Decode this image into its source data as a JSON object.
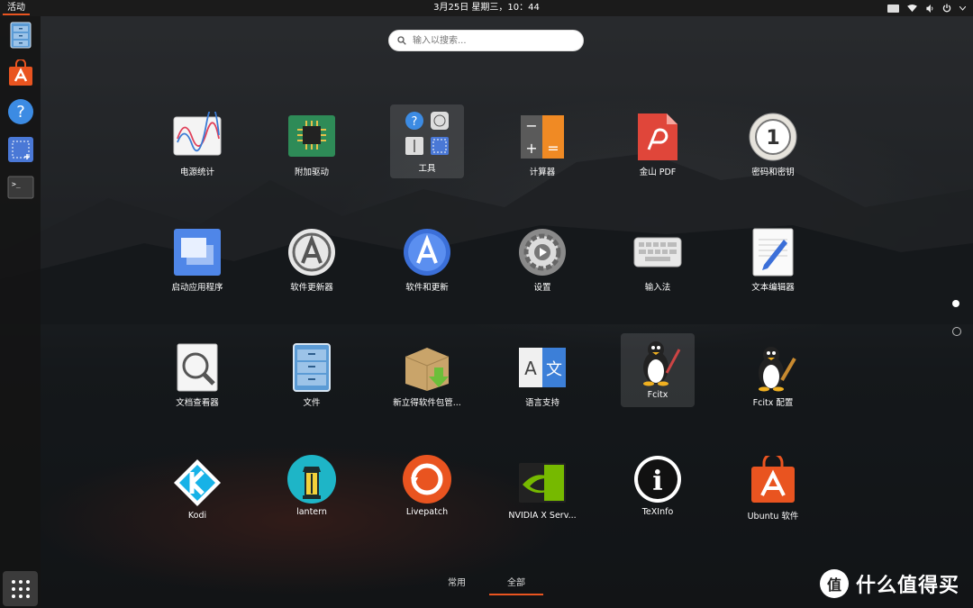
{
  "topbar": {
    "activities": "活动",
    "clock": "3月25日 星期三，10：44"
  },
  "dock": {
    "items": [
      {
        "name": "files",
        "icon": "file-cabinet-icon"
      },
      {
        "name": "ubuntu-software",
        "icon": "shopping-bag-icon"
      },
      {
        "name": "help",
        "icon": "question-icon"
      },
      {
        "name": "screenshot",
        "icon": "screenshot-icon"
      },
      {
        "name": "terminal",
        "icon": "terminal-icon"
      }
    ],
    "terminal_prompt": ">_"
  },
  "search": {
    "placeholder": "输入以搜索..."
  },
  "apps": [
    {
      "label": "电源统计",
      "icon": "power-statistics-icon"
    },
    {
      "label": "附加驱动",
      "icon": "chip-icon"
    },
    {
      "label": "工具",
      "icon": "utilities-folder-icon"
    },
    {
      "label": "计算器",
      "icon": "calculator-icon"
    },
    {
      "label": "金山 PDF",
      "icon": "pdf-icon"
    },
    {
      "label": "密码和密钥",
      "icon": "keyring-icon"
    },
    {
      "label": "启动应用程序",
      "icon": "startup-apps-icon"
    },
    {
      "label": "软件更新器",
      "icon": "software-updater-icon"
    },
    {
      "label": "软件和更新",
      "icon": "software-properties-icon"
    },
    {
      "label": "设置",
      "icon": "settings-gear-icon"
    },
    {
      "label": "输入法",
      "icon": "keyboard-icon"
    },
    {
      "label": "文本编辑器",
      "icon": "text-editor-icon"
    },
    {
      "label": "文档查看器",
      "icon": "document-viewer-icon"
    },
    {
      "label": "文件",
      "icon": "file-cabinet-icon"
    },
    {
      "label": "新立得软件包管...",
      "icon": "package-box-icon"
    },
    {
      "label": "语言支持",
      "icon": "language-icon"
    },
    {
      "label": "Fcitx",
      "icon": "penguin-icon"
    },
    {
      "label": "Fcitx 配置",
      "icon": "penguin-config-icon"
    },
    {
      "label": "Kodi",
      "icon": "kodi-icon"
    },
    {
      "label": "lantern",
      "icon": "lantern-icon"
    },
    {
      "label": "Livepatch",
      "icon": "livepatch-icon"
    },
    {
      "label": "NVIDIA X Serv...",
      "icon": "nvidia-icon"
    },
    {
      "label": "TeXInfo",
      "icon": "info-icon"
    },
    {
      "label": "Ubuntu 软件",
      "icon": "ubuntu-software-icon"
    }
  ],
  "icon_text": {
    "question": "?",
    "calc_minus": "−",
    "calc_plus": "+",
    "calc_eq": "=",
    "lang_a": "A",
    "lang_wen": "文",
    "info": "i",
    "keyring": "1"
  },
  "tabs": [
    {
      "label": "常用",
      "active": false
    },
    {
      "label": "全部",
      "active": true
    }
  ],
  "pages": {
    "current": 1,
    "total": 2
  },
  "watermark": {
    "badge": "值",
    "text": "什么值得买"
  },
  "colors": {
    "accent": "#e95420",
    "topbar": "#1b1b1b",
    "dock": "#141414"
  }
}
